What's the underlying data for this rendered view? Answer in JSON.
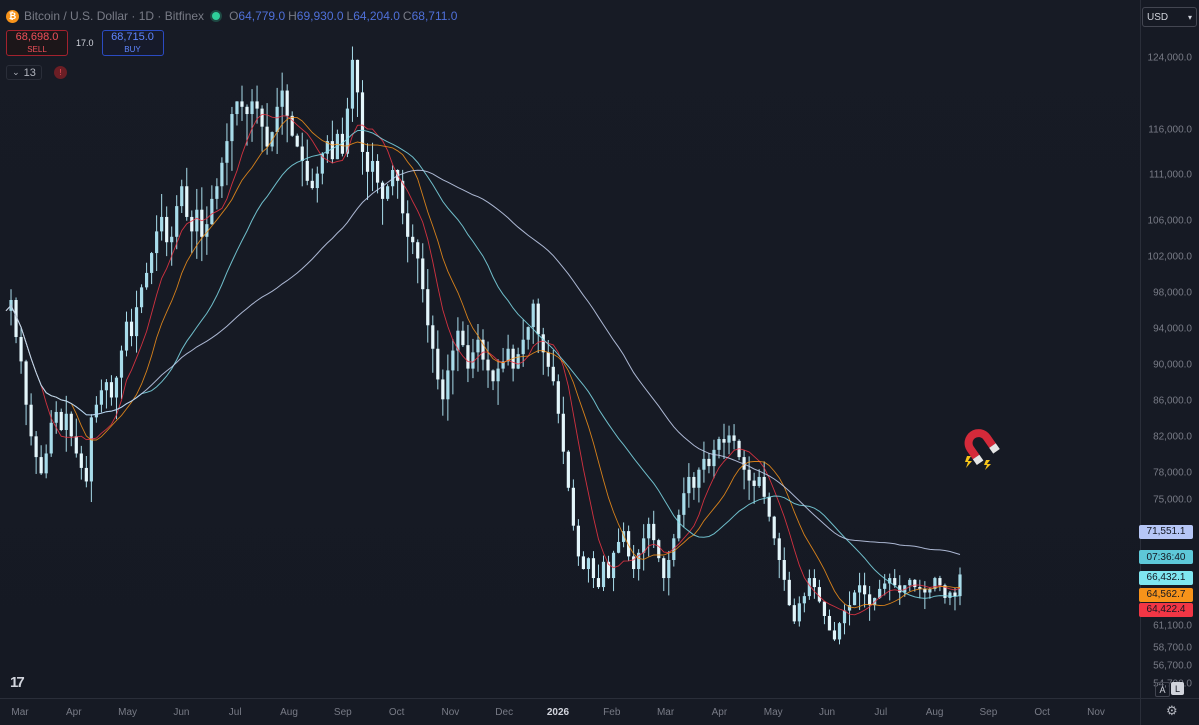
{
  "header": {
    "title": "Bitcoin / U.S. Dollar · 1D · Bitfinex",
    "btc_icon_glyph": "₿",
    "ohlc": [
      {
        "key": "O",
        "value": "64,779.0"
      },
      {
        "key": "H",
        "value": "69,930.0"
      },
      {
        "key": "L",
        "value": "64,204.0"
      },
      {
        "key": "C",
        "value": "68,711.0"
      }
    ]
  },
  "trade": {
    "sell_price": "68,698.0",
    "sell_label": "SELL",
    "spread": "17.0",
    "buy_price": "68,715.0",
    "buy_label": "BUY"
  },
  "indicators": {
    "count": "13",
    "alert_glyph": "!"
  },
  "currency": {
    "value": "USD"
  },
  "price_axis_labels": [
    {
      "value": 124000,
      "text": "124,000.0"
    },
    {
      "value": 116000,
      "text": "116,000.0"
    },
    {
      "value": 111000,
      "text": "111,000.0"
    },
    {
      "value": 106000,
      "text": "106,000.0"
    },
    {
      "value": 102000,
      "text": "102,000.0"
    },
    {
      "value": 98000,
      "text": "98,000.0"
    },
    {
      "value": 94000,
      "text": "94,000.0"
    },
    {
      "value": 90000,
      "text": "90,000.0"
    },
    {
      "value": 86000,
      "text": "86,000.0"
    },
    {
      "value": 82000,
      "text": "82,000.0"
    },
    {
      "value": 78000,
      "text": "78,000.0"
    },
    {
      "value": 75000,
      "text": "75,000.0"
    },
    {
      "value": 61100,
      "text": "61,100.0"
    },
    {
      "value": 58700,
      "text": "58,700.0"
    },
    {
      "value": 56700,
      "text": "56,700.0"
    },
    {
      "value": 54700,
      "text": "54,700.0"
    }
  ],
  "price_labels": [
    {
      "value": 71551.1,
      "text": "71,551.1",
      "color": "#b6c6f6"
    },
    {
      "value": 68711,
      "text": "07:36:40",
      "color": "#5ec8d8"
    },
    {
      "value": 66432.1,
      "text": "66,432.1",
      "color": "#7fe6f0"
    },
    {
      "value": 64562.7,
      "text": "64,562.7",
      "color": "#f7931a"
    },
    {
      "value": 64422.4,
      "text": "64,422.4",
      "color": "#f23645"
    }
  ],
  "time_axis": [
    {
      "label": "Mar",
      "bold": false
    },
    {
      "label": "Apr",
      "bold": false
    },
    {
      "label": "May",
      "bold": false
    },
    {
      "label": "Jun",
      "bold": false
    },
    {
      "label": "Jul",
      "bold": false
    },
    {
      "label": "Aug",
      "bold": false
    },
    {
      "label": "Sep",
      "bold": false
    },
    {
      "label": "Oct",
      "bold": false
    },
    {
      "label": "Nov",
      "bold": false
    },
    {
      "label": "Dec",
      "bold": false
    },
    {
      "label": "2026",
      "bold": true
    },
    {
      "label": "Feb",
      "bold": false
    },
    {
      "label": "Mar",
      "bold": false
    },
    {
      "label": "Apr",
      "bold": false
    },
    {
      "label": "May",
      "bold": false
    },
    {
      "label": "Jun",
      "bold": false
    },
    {
      "label": "Jul",
      "bold": false
    },
    {
      "label": "Aug",
      "bold": false
    },
    {
      "label": "Sep",
      "bold": false
    },
    {
      "label": "Oct",
      "bold": false
    },
    {
      "label": "Nov",
      "bold": false
    }
  ],
  "bottom": {
    "logo": "17",
    "auto_label": "A",
    "log_label": "L",
    "settings_glyph": "⚙"
  },
  "colors": {
    "candle": "#a8dcea",
    "ema_fast": "#f23645",
    "ema_mid": "#f7931a",
    "ma_teal": "#7fdbe8",
    "ma_long": "#c7d3f2"
  },
  "chart_data": {
    "type": "line",
    "title": "",
    "ylim": [
      54000,
      126000
    ],
    "series": [
      {
        "values": [
          96000,
          97200,
          93100,
          90400,
          85600,
          82100,
          79800,
          78000,
          80200,
          83600,
          84800,
          82800,
          84600,
          82100,
          80200,
          78600,
          77100,
          84200,
          85600,
          87200,
          88100,
          86400,
          88600,
          91600,
          94800,
          93200,
          96400,
          98600,
          100200,
          102400,
          104800,
          106400,
          103600,
          104200,
          107600,
          109800,
          106400,
          104800,
          107200,
          104200,
          105600,
          108400,
          109800,
          112400,
          114800,
          117800,
          119200,
          118600,
          117800,
          119200,
          118400,
          116400,
          114200,
          115800,
          118600,
          120400,
          117600,
          115400,
          114200,
          112600,
          110400,
          109600,
          111200,
          113400,
          114800,
          112800,
          115600,
          113400,
          118400,
          123800,
          120200,
          113600,
          111400,
          112600,
          110200,
          108400,
          109800,
          111600,
          110400,
          106800,
          104200,
          103600,
          101800,
          98400,
          94400,
          91800,
          88400,
          86200,
          89400,
          91600,
          93800,
          92200,
          89600,
          91400,
          92800,
          90600,
          89400,
          88200,
          89600,
          90400,
          91800,
          89600,
          91200,
          92800,
          94200,
          96800,
          93400,
          91400,
          89800,
          88200,
          84600,
          80400,
          76400,
          72200,
          68800,
          67400,
          68600,
          66400,
          65400,
          68200,
          66400,
          69200,
          70400,
          71600,
          68800,
          67400,
          69200,
          70800,
          72400,
          70600,
          68600,
          66400,
          68400,
          70800,
          73400,
          75800,
          77600,
          76400,
          78400,
          79600,
          78800,
          80600,
          81800,
          81400,
          82200,
          81600,
          79800,
          78400,
          77200,
          76600,
          77600,
          75400,
          73200,
          70800,
          68400,
          66200,
          63400,
          61600,
          63600,
          64400,
          66400,
          65400,
          63800,
          62200,
          60600,
          59600,
          61400,
          62800,
          63400,
          64800,
          65600,
          64600,
          63400,
          64200,
          65200,
          65800,
          66400,
          65600,
          64800,
          65600,
          66200,
          65400,
          65200,
          64800,
          65200,
          66400,
          65600,
          64200,
          64800,
          64400,
          66800
        ]
      }
    ]
  }
}
